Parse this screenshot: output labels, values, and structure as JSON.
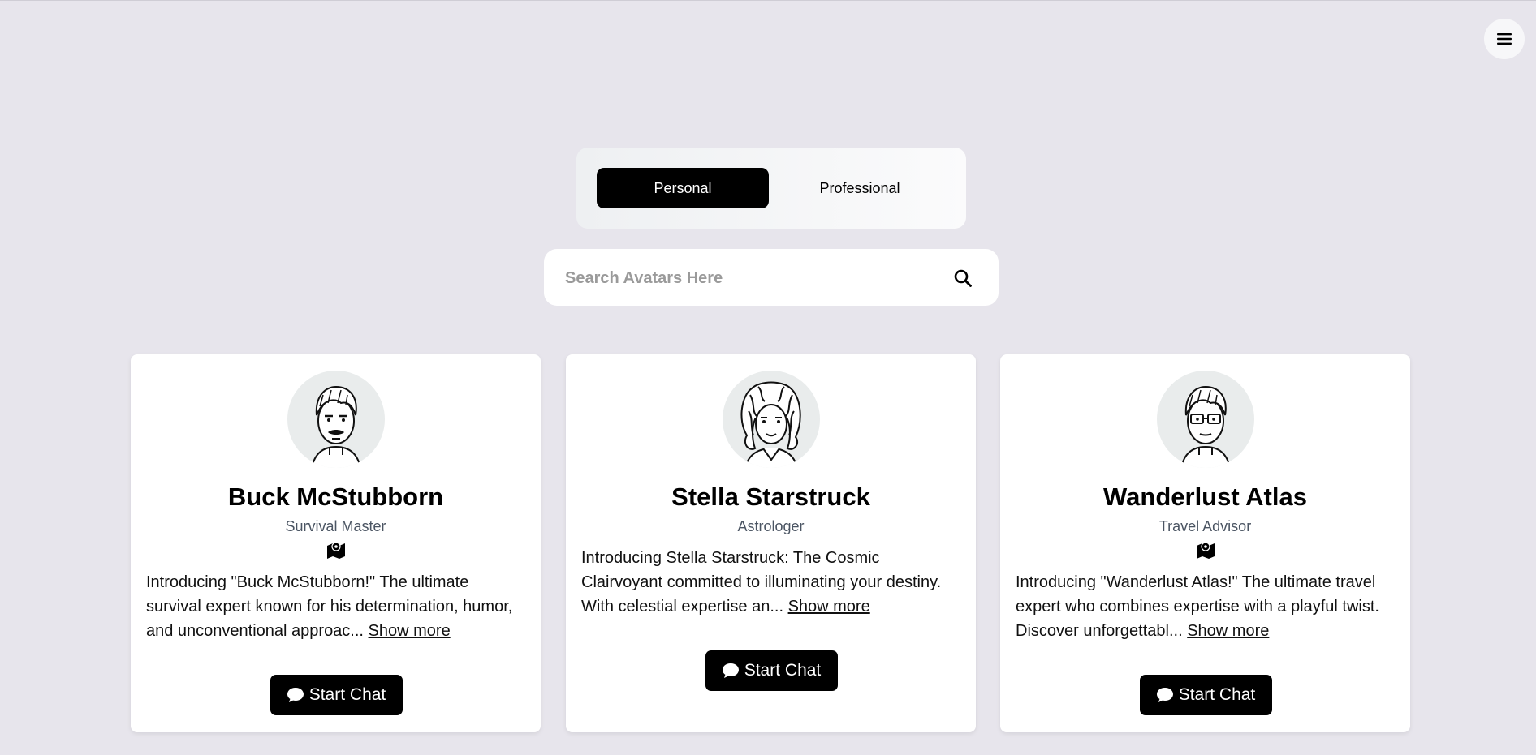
{
  "header": {
    "menu_icon": "hamburger-menu-icon"
  },
  "tabs": {
    "personal": "Personal",
    "professional": "Professional",
    "active": "Personal"
  },
  "search": {
    "placeholder": "Search Avatars Here",
    "value": "",
    "icon": "search-icon"
  },
  "cards": [
    {
      "name": "Buck McStubborn",
      "role": "Survival Master",
      "role_icon": "map-icon",
      "description": "Introducing \"Buck McStubborn!\" The ultimate survival expert known for his determination, humor, and unconventional approac...",
      "show_more": "Show more",
      "button": "Start Chat"
    },
    {
      "name": "Stella Starstruck",
      "role": "Astrologer",
      "description": "Introducing Stella Starstruck: The Cosmic Clairvoyant committed to illuminating your destiny. With celestial expertise an...",
      "show_more": "Show more",
      "button": "Start Chat"
    },
    {
      "name": "Wanderlust Atlas",
      "role": "Travel Advisor",
      "role_icon": "map-icon",
      "description": "Introducing \"Wanderlust Atlas!\" The ultimate travel expert who combines expertise with a playful twist. Discover unforgettabl...",
      "show_more": "Show more",
      "button": "Start Chat"
    }
  ],
  "colors": {
    "background": "#e7e5ec",
    "button": "#000000",
    "card": "#ffffff"
  }
}
